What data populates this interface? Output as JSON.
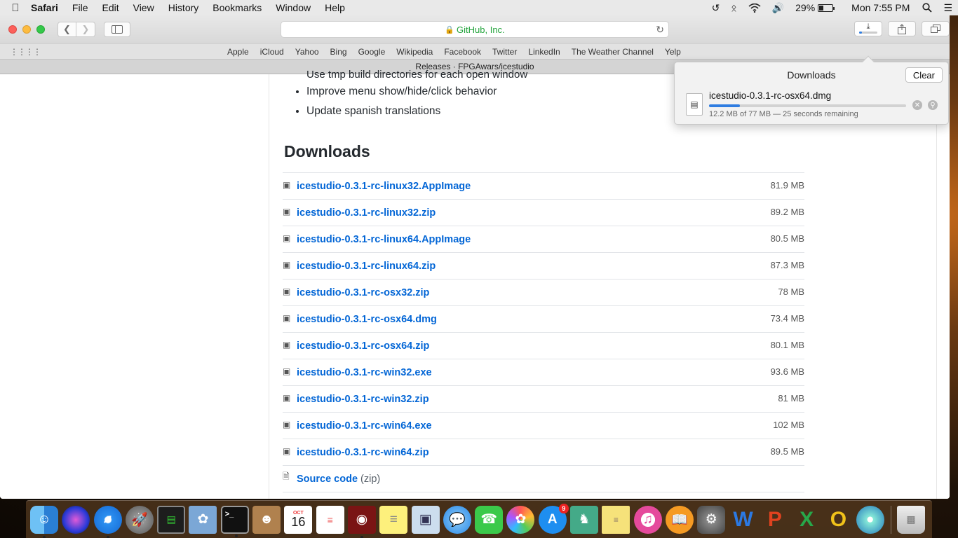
{
  "menubar": {
    "apple": "",
    "app_name": "Safari",
    "items": [
      "File",
      "Edit",
      "View",
      "History",
      "Bookmarks",
      "Window",
      "Help"
    ],
    "battery_percent": "29%",
    "clock": "Mon 7:55 PM"
  },
  "toolbar": {
    "address": "GitHub, Inc."
  },
  "favorites": [
    "Apple",
    "iCloud",
    "Yahoo",
    "Bing",
    "Google",
    "Wikipedia",
    "Facebook",
    "Twitter",
    "LinkedIn",
    "The Weather Channel",
    "Yelp"
  ],
  "tab": {
    "title": "Releases · FPGAwars/icestudio"
  },
  "page": {
    "clipped_bullet": "Use tmp build directories for each open window",
    "bullets": [
      "Improve menu show/hide/click behavior",
      "Update spanish translations"
    ],
    "downloads_heading": "Downloads",
    "assets": [
      {
        "name": "icestudio-0.3.1-rc-linux32.AppImage",
        "size": "81.9 MB"
      },
      {
        "name": "icestudio-0.3.1-rc-linux32.zip",
        "size": "89.2 MB"
      },
      {
        "name": "icestudio-0.3.1-rc-linux64.AppImage",
        "size": "80.5 MB"
      },
      {
        "name": "icestudio-0.3.1-rc-linux64.zip",
        "size": "87.3 MB"
      },
      {
        "name": "icestudio-0.3.1-rc-osx32.zip",
        "size": "78 MB"
      },
      {
        "name": "icestudio-0.3.1-rc-osx64.dmg",
        "size": "73.4 MB"
      },
      {
        "name": "icestudio-0.3.1-rc-osx64.zip",
        "size": "80.1 MB"
      },
      {
        "name": "icestudio-0.3.1-rc-win32.exe",
        "size": "93.6 MB"
      },
      {
        "name": "icestudio-0.3.1-rc-win32.zip",
        "size": "81 MB"
      },
      {
        "name": "icestudio-0.3.1-rc-win64.exe",
        "size": "102 MB"
      },
      {
        "name": "icestudio-0.3.1-rc-win64.zip",
        "size": "89.5 MB"
      }
    ],
    "source_code": {
      "label": "Source code",
      "suffix": "(zip)"
    }
  },
  "downloads_popover": {
    "title": "Downloads",
    "clear_label": "Clear",
    "file_name": "icestudio-0.3.1-rc-osx64.dmg",
    "status": "12.2 MB of 77 MB — 25 seconds remaining",
    "progress_fraction": 0.158
  },
  "dock": {
    "calendar_month": "OCT",
    "calendar_day": "16",
    "app_store_badge": "9",
    "apps": [
      "finder-icon",
      "siri-icon",
      "safari-icon",
      "launchpad-icon",
      "activity-monitor-icon",
      "preview-icon",
      "terminal-icon",
      "contacts-icon",
      "calendar-icon",
      "reminders-icon",
      "photo-booth-icon",
      "notes-icon",
      "image-capture-icon",
      "messages-icon",
      "facetime-icon",
      "photos-icon",
      "app-store-icon",
      "chess-icon",
      "stickies-icon",
      "itunes-icon",
      "ibooks-icon",
      "system-preferences-icon",
      "word-icon",
      "powerpoint-icon",
      "excel-icon",
      "outlook-icon",
      "network-icon",
      "trash-icon"
    ]
  },
  "colors": {
    "link": "#0366d6",
    "accent": "#2f7de1",
    "secure_green": "#22a33b"
  }
}
